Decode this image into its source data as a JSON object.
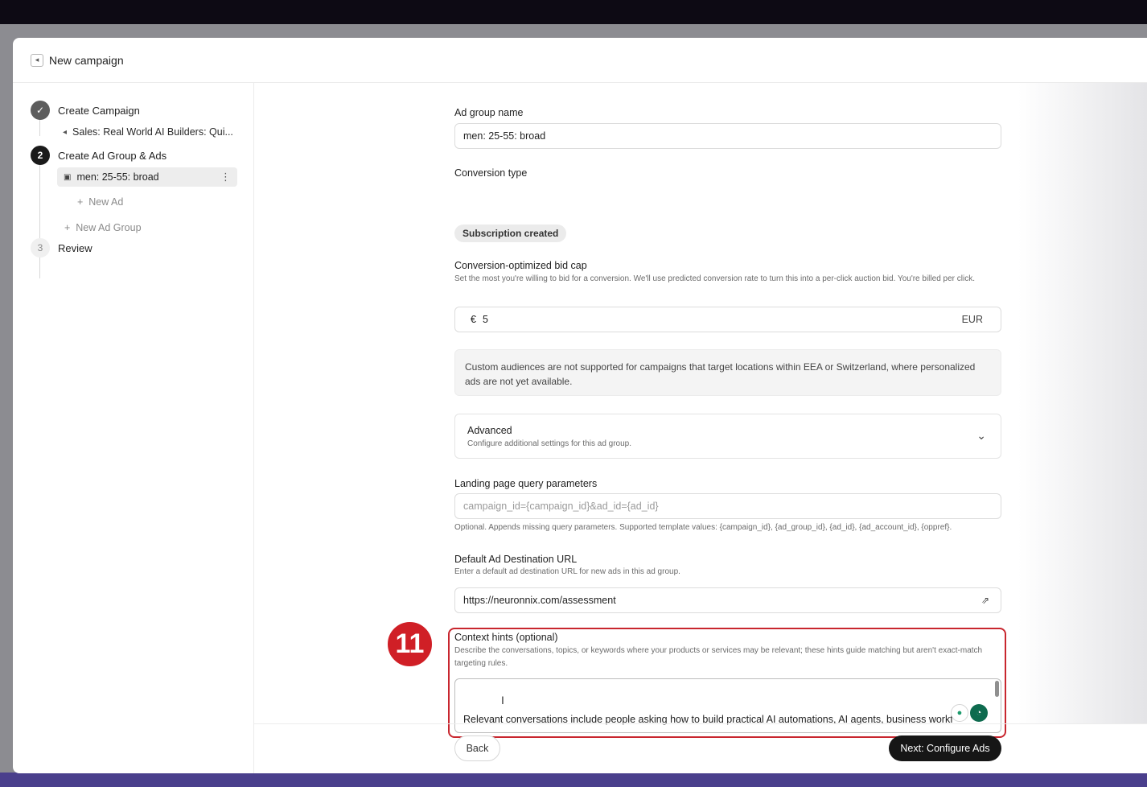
{
  "modal": {
    "title": "New campaign",
    "title_icon": "megaphone-icon"
  },
  "steps": [
    {
      "number": "✓",
      "label": "Create Campaign",
      "state": "done"
    },
    {
      "number": "2",
      "label": "Create Ad Group & Ads",
      "state": "active"
    },
    {
      "number": "3",
      "label": "Review",
      "state": "pending"
    }
  ],
  "sidebar": {
    "campaign_item": "Sales: Real World AI Builders: Qui...",
    "ad_group_item": "men: 25-55: broad",
    "new_ad": "New Ad",
    "new_ad_group": "New Ad Group"
  },
  "form": {
    "ad_group_name": {
      "label": "Ad group name",
      "value": "men: 25-55: broad"
    },
    "conversion_type": {
      "label": "Conversion type",
      "value": "Subscription created"
    },
    "bid_cap": {
      "label": "Conversion-optimized bid cap",
      "help": "Set the most you're willing to bid for a conversion. We'll use predicted conversion rate to turn this into a per-click auction bid. You're billed per click.",
      "currency_symbol": "€",
      "value": "5",
      "currency": "EUR"
    },
    "notice": "Custom audiences are not supported for campaigns that target locations within EEA or Switzerland, where personalized ads are not yet available.",
    "advanced": {
      "title": "Advanced",
      "subtitle": "Configure additional settings for this ad group."
    },
    "query_params": {
      "label": "Landing page query parameters",
      "placeholder": "campaign_id={campaign_id}&ad_id={ad_id}",
      "help": "Optional. Appends missing query parameters. Supported template values: {campaign_id}, {ad_group_id}, {ad_id}, {ad_account_id}, {oppref}."
    },
    "destination_url": {
      "label": "Default Ad Destination URL",
      "help": "Enter a default ad destination URL for new ads in this ad group.",
      "value": "https://neuronnix.com/assessment"
    },
    "context_hints": {
      "label": "Context hints (optional)",
      "help": "Describe the conversations, topics, or keywords where your products or services may be relevant; these hints guide matching but aren't exact-match targeting rules.",
      "value_line1": "Relevant conversations include people asking how to build practical AI automations, AI agents, business workfl"
    }
  },
  "annotation": {
    "step_number": "11"
  },
  "footer": {
    "back": "Back",
    "next": "Next: Configure Ads"
  },
  "colors": {
    "annotation_red": "#d01f26",
    "primary_button": "#161616"
  }
}
